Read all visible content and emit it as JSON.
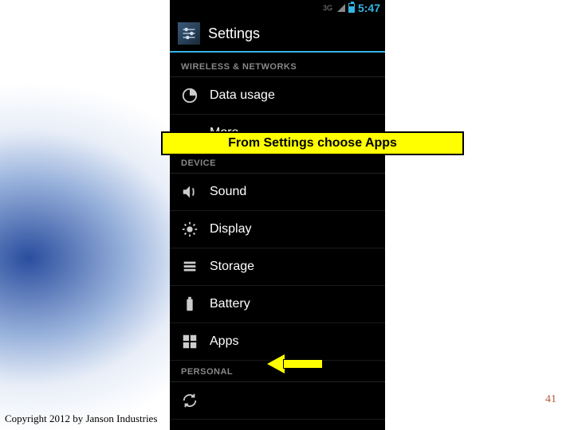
{
  "status": {
    "network": "3G",
    "time": "5:47"
  },
  "header": {
    "title": "Settings"
  },
  "sections": {
    "wireless": {
      "label": "WIRELESS & NETWORKS",
      "items": {
        "data_usage": "Data usage",
        "more": "More..."
      }
    },
    "device": {
      "label": "DEVICE",
      "items": {
        "sound": "Sound",
        "display": "Display",
        "storage": "Storage",
        "battery": "Battery",
        "apps": "Apps"
      }
    },
    "personal": {
      "label": "PERSONAL"
    }
  },
  "callout": {
    "text": "From Settings choose Apps"
  },
  "footer": {
    "copyright": "Copyright 2012 by Janson Industries",
    "slide_number": "41"
  }
}
